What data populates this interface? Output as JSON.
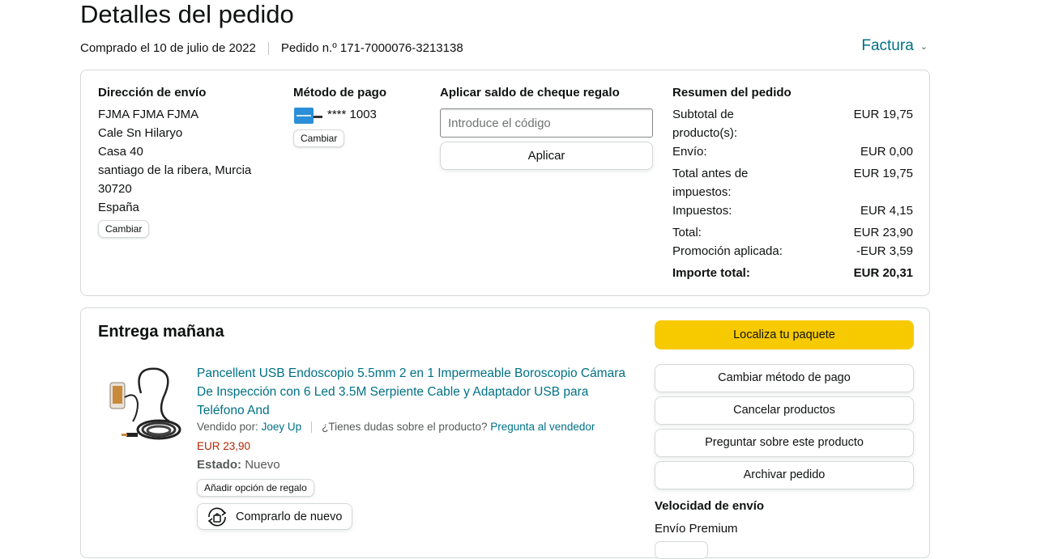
{
  "header": {
    "title": "Detalles del pedido",
    "purchased": "Comprado el 10 de julio de 2022",
    "order_number": "Pedido n.º 171-7000076-3213138",
    "invoice_label": "Factura"
  },
  "shipping": {
    "heading": "Dirección de envío",
    "lines": [
      "FJMA FJMA FJMA",
      "Cale Sn Hilaryo",
      "Casa 40",
      "santiago de la ribera, Murcia",
      "30720",
      "España"
    ],
    "change_label": "Cambiar"
  },
  "payment": {
    "heading": "Método de pago",
    "card_digits": "**** 1003",
    "change_label": "Cambiar"
  },
  "gift": {
    "heading": "Aplicar saldo de cheque regalo",
    "placeholder": "Introduce el código",
    "apply_label": "Aplicar"
  },
  "summary": {
    "heading": "Resumen del pedido",
    "rows": [
      {
        "label": "Subtotal de producto(s):",
        "value": "EUR 19,75"
      },
      {
        "label": "Envío:",
        "value": "EUR 0,00"
      },
      {
        "label": "Total antes de impuestos:",
        "value": "EUR 19,75"
      },
      {
        "label": "Impuestos:",
        "value": "EUR 4,15"
      },
      {
        "label": "Total:",
        "value": "EUR 23,90"
      },
      {
        "label": "Promoción aplicada:",
        "value": "-EUR 3,59"
      },
      {
        "label": "Importe total:",
        "value": "EUR 20,31"
      }
    ]
  },
  "delivery": {
    "heading": "Entrega mañana",
    "product_title": "Pancellent USB Endoscopio 5.5mm 2 en 1 Impermeable Boroscopio Cámara De Inspección con 6 Led 3.5M Serpiente Cable y Adaptador USB para Teléfono And",
    "sold_by_label": "Vendido por:",
    "seller": "Joey Up",
    "question_text": "¿Tienes dudas sobre el producto?",
    "ask_seller": "Pregunta al vendedor",
    "price": "EUR 23,90",
    "status_label": "Estado:",
    "status_value": "Nuevo",
    "gift_option": "Añadir opción de regalo",
    "buy_again": "Comprarlo de nuevo"
  },
  "actions": {
    "track": "Localiza tu paquete",
    "change_payment": "Cambiar método de pago",
    "cancel": "Cancelar productos",
    "ask_product": "Preguntar sobre este producto",
    "archive": "Archivar pedido",
    "speed_heading": "Velocidad de envío",
    "speed_value": "Envío Premium"
  },
  "colors": {
    "link": "#007185",
    "price": "#b12704",
    "primary_button": "#f7ca00",
    "border": "#d5d9d9"
  }
}
